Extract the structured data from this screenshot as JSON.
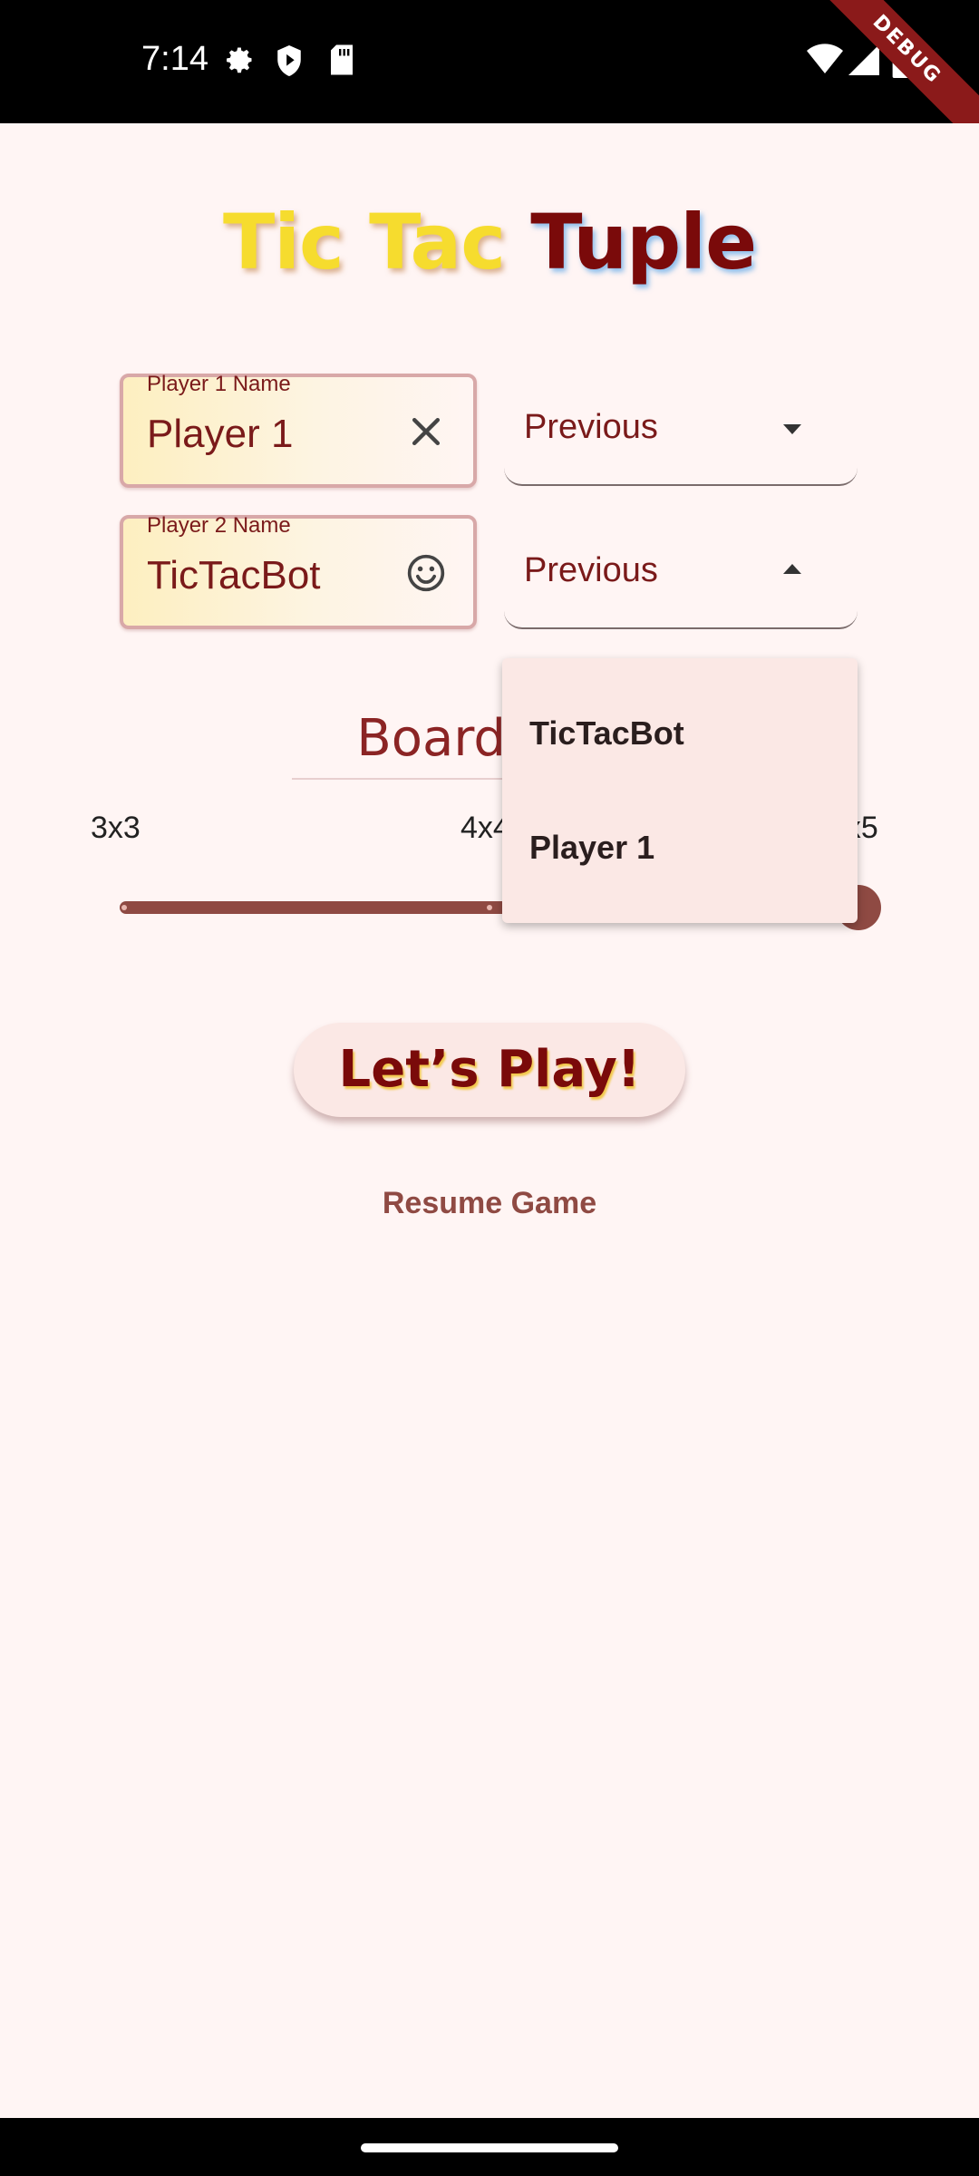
{
  "status_bar": {
    "time": "7:14",
    "debug_label": "DEBUG"
  },
  "title": {
    "part1": "Tic Tac ",
    "part2": "Tuple"
  },
  "player1": {
    "label": "Player 1 Name",
    "value": "Player 1",
    "icon": "clear-icon"
  },
  "player2": {
    "label": "Player 2 Name",
    "value": "TicTacBot",
    "icon": "smiley-icon"
  },
  "dropdown1": {
    "label": "Previous",
    "expanded": false
  },
  "dropdown2": {
    "label": "Previous",
    "expanded": true
  },
  "dropdown_menu": {
    "items": [
      "TicTacBot",
      "Player 1"
    ]
  },
  "board_size": {
    "label": "Board Size",
    "ticks": [
      "3x3",
      "4x4",
      "5x5"
    ],
    "selected": "5x5"
  },
  "buttons": {
    "play": "Let’s Play!",
    "resume": "Resume Game"
  },
  "colors": {
    "accent": "#8f4a43",
    "title_dark": "#7a0a0a",
    "title_yellow": "#f6dc2e",
    "background": "#fff5f4"
  }
}
